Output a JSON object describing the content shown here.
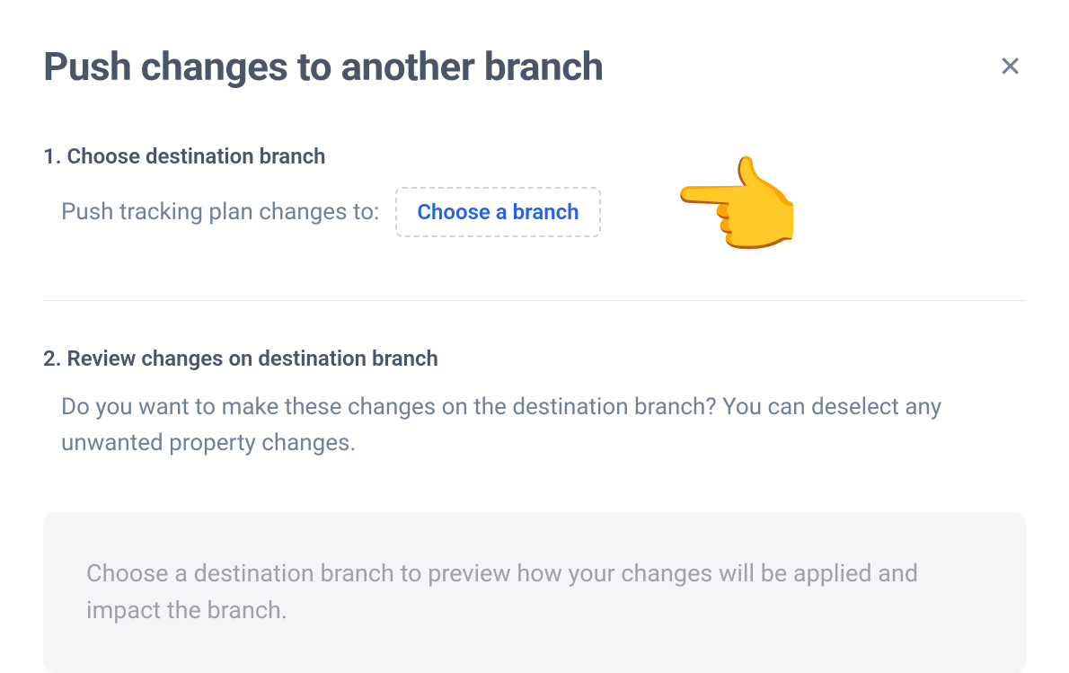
{
  "header": {
    "title": "Push changes to another branch"
  },
  "step1": {
    "label": "1. Choose destination branch",
    "prompt": "Push tracking plan changes to:",
    "button": "Choose a branch"
  },
  "step2": {
    "label": "2. Review changes on destination branch",
    "description": "Do you want to make these changes on the destination branch? You can deselect any unwanted property changes."
  },
  "preview": {
    "message": "Choose a destination branch to preview how your changes will be applied and impact the branch."
  },
  "pointer": {
    "glyph": "👉"
  }
}
